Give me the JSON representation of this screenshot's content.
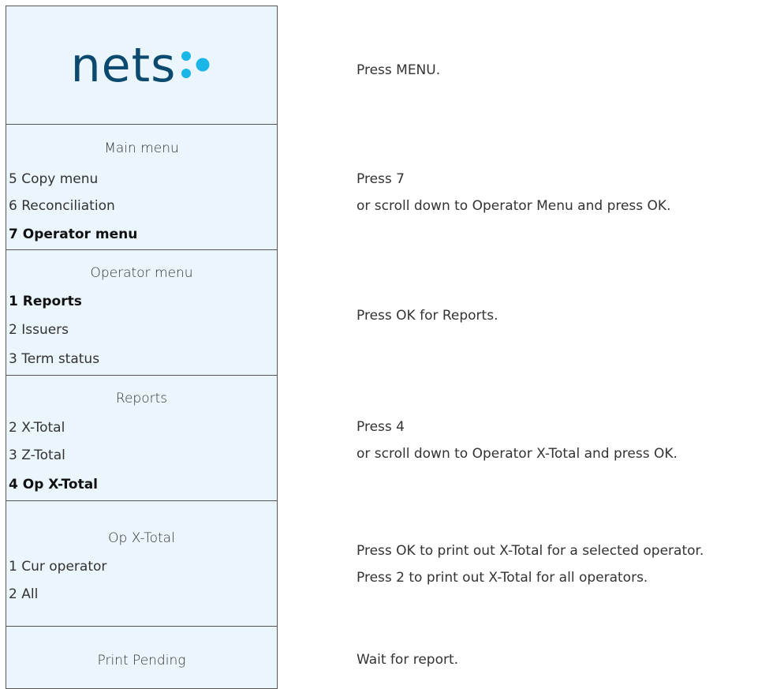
{
  "logo": {
    "text": "nets",
    "dot_color": "#1cb5e8",
    "text_color": "#0b4a6e"
  },
  "steps": [
    {
      "instructions": [
        "Press MENU."
      ]
    },
    {
      "screen": {
        "title": "Main menu",
        "items": [
          "5 Copy menu",
          "6 Reconciliation",
          "7 Operator menu"
        ],
        "selected": "7 Operator menu"
      },
      "instructions": [
        "Press 7",
        "or scroll down to Operator Menu and press OK."
      ]
    },
    {
      "screen": {
        "title": "Operator menu",
        "items": [
          "1 Reports",
          "2 Issuers",
          "3 Term status"
        ],
        "selected": "1 Reports"
      },
      "instructions": [
        "Press OK for Reports."
      ]
    },
    {
      "screen": {
        "title": "Reports",
        "items": [
          "2 X-Total",
          "3 Z-Total",
          "4 Op X-Total"
        ],
        "selected": "4 Op X-Total"
      },
      "instructions": [
        "Press 4",
        "or scroll down to Operator X-Total and press OK."
      ]
    },
    {
      "screen": {
        "title": "Op X-Total",
        "items": [
          "1 Cur operator",
          "2 All"
        ]
      },
      "instructions": [
        "Press OK to print out X-Total for a selected operator.",
        "Press 2 to print out X-Total for all operators."
      ]
    },
    {
      "screen": {
        "title": "Print Pending",
        "items": []
      },
      "instructions": [
        "Wait for report."
      ]
    }
  ]
}
